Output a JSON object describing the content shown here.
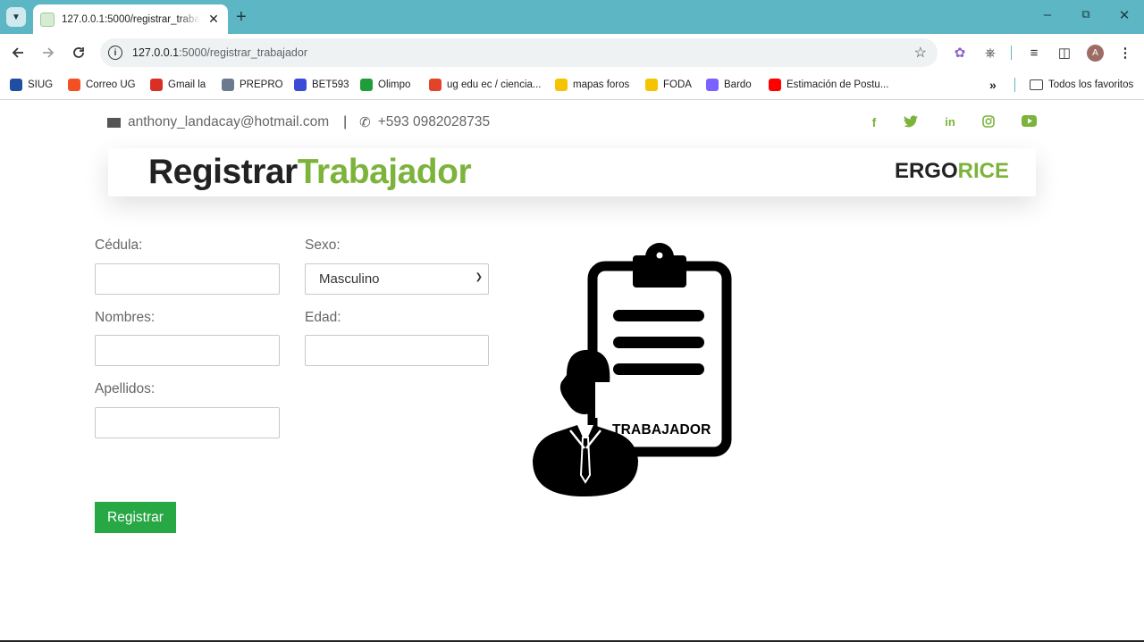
{
  "browser": {
    "tab_title": "127.0.0.1:5000/registrar_trabajador",
    "url_host": "127.0.0.1",
    "url_path": ":5000/registrar_trabajador",
    "bookmarks": [
      {
        "label": "SIUG",
        "icon": "ug-icon",
        "color": "#1f4fa3"
      },
      {
        "label": "Correo UG",
        "icon": "microsoft-icon",
        "color": "#f25022"
      },
      {
        "label": "Gmail la",
        "icon": "gmail-icon",
        "color": "#d93025"
      },
      {
        "label": "PREPRO",
        "icon": "document-icon",
        "color": "#6b7a8f"
      },
      {
        "label": "BET593",
        "icon": "bet-icon",
        "color": "#3b4bd6"
      },
      {
        "label": "Olimpo",
        "icon": "olimpo-icon",
        "color": "#1e9e3a"
      },
      {
        "label": "ug edu ec / ciencia...",
        "icon": "gitlab-icon",
        "color": "#e24329"
      },
      {
        "label": "mapas foros",
        "icon": "miro-icon",
        "color": "#f5c400"
      },
      {
        "label": "FODA",
        "icon": "miro-icon",
        "color": "#f5c400"
      },
      {
        "label": "Bardo",
        "icon": "sparkle-icon",
        "color": "#7b61ff"
      },
      {
        "label": "Estimación de Postu...",
        "icon": "youtube-icon",
        "color": "#ff0000"
      }
    ],
    "all_bookmarks": "Todos los favoritos",
    "profile_initial": "A"
  },
  "contact": {
    "email": "anthony_landacay@hotmail.com",
    "separator": "|",
    "phone": "+593 0982028735"
  },
  "header": {
    "title_dark": "Registrar",
    "title_green": "Trabajador",
    "brand_dark": "ERGO",
    "brand_green": "RICE"
  },
  "form": {
    "cedula_label": "Cédula:",
    "sexo_label": "Sexo:",
    "sexo_value": "Masculino",
    "nombres_label": "Nombres:",
    "edad_label": "Edad:",
    "apellidos_label": "Apellidos:",
    "submit_label": "Registrar"
  },
  "illustration": {
    "caption": "TRABAJADOR"
  },
  "colors": {
    "accent_green": "#7cb33b",
    "button_green": "#28a745",
    "chrome_teal": "#5cb6c4"
  }
}
